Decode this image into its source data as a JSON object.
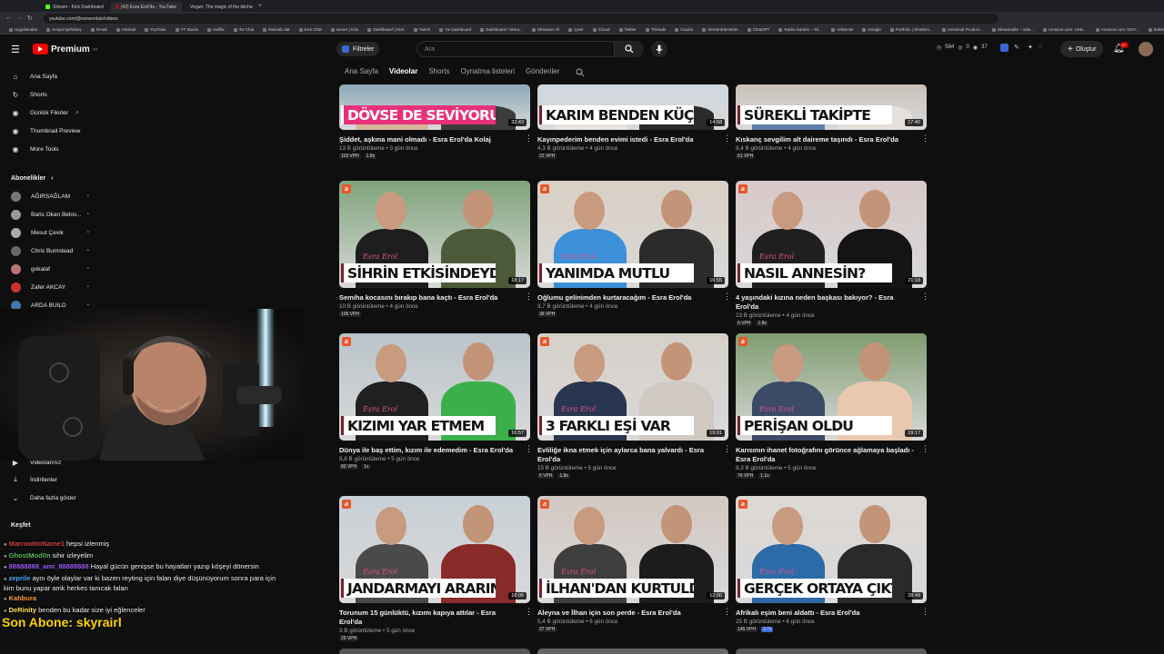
{
  "browser": {
    "tabs": [
      {
        "label": "Stream - Kick Dashboard",
        "color": "#53fc18"
      },
      {
        "label": "(42) Esra Erol'da - YouTube",
        "color": "#ff0000"
      },
      {
        "label": "Vegun: The magic of the kitchen",
        "color": "#4aa8ff"
      }
    ],
    "url": "youtube.com/@esraerolatv/videos",
    "bookmarks": [
      "Uygulamalar",
      "Sosyal Şehirbey",
      "Gmail",
      "Hotmail",
      "YouTube",
      "YT Studio",
      "Netflix",
      "Tw Chat",
      "festivali.clat",
      "Kick Chat",
      "server | Kick",
      "Dashboard | Kick",
      "Twitch",
      "Tw Dashboard",
      "Dashboard / Strea...",
      "Streamer Ali",
      "Çevir",
      "iCloud",
      "Twitter",
      "Threads",
      "Oculus",
      "StreamElements",
      "ChatGPT",
      "Radio Garden – Kil...",
      "AdSense",
      "Google",
      "Portfolio | Shutters...",
      "Universal Product...",
      "Streamable – vide...",
      "Amazon.com: USB...",
      "Amazon.com: NOV...",
      "Subreit a request...",
      "Drive & Listen",
      "Tüm Yer İşaretleri"
    ]
  },
  "header": {
    "logo": "Premium",
    "logo_sup": "TR",
    "filter_label": "Filtreler",
    "search_placeholder": "Ara",
    "stats": {
      "views": "584",
      "likes": "0",
      "watch": "37"
    },
    "create_label": "Oluştur",
    "notif_count": "9+"
  },
  "channel_tabs": [
    "Ana Sayfa",
    "Videolar",
    "Shorts",
    "Oynatma listeleri",
    "Gönderiler"
  ],
  "sidebar": {
    "items": [
      {
        "label": "Ana Sayfa",
        "icon": "home-icon",
        "glyph": "⌂"
      },
      {
        "label": "Shorts",
        "icon": "shorts-icon",
        "glyph": "↻"
      },
      {
        "label": "Günlük Fikirler",
        "icon": "ideas-icon",
        "glyph": "◉"
      },
      {
        "label": "Thumbnail Preview",
        "icon": "thumbnail-icon",
        "glyph": "◉"
      },
      {
        "label": "More Tools",
        "icon": "tools-icon",
        "glyph": "◉"
      }
    ],
    "subs_heading": "Abonelikler",
    "subs": [
      {
        "name": "AĞIRSAĞLAM",
        "color": "#777"
      },
      {
        "name": "Baris Okan Belov...",
        "color": "#999"
      },
      {
        "name": "Mesut Çevik",
        "color": "#aaa"
      },
      {
        "name": "Chris Bumstead",
        "color": "#666"
      },
      {
        "name": "gokalaf",
        "color": "#b77"
      },
      {
        "name": "Zafer AKCAY",
        "color": "#c33"
      },
      {
        "name": "ARDA BUILD",
        "color": "#47a"
      }
    ],
    "lower": [
      {
        "label": "Videolarınız",
        "icon": "play-icon",
        "glyph": "▶"
      },
      {
        "label": "İndirilenler",
        "icon": "download-icon",
        "glyph": "⤓"
      },
      {
        "label": "Daha fazla göster",
        "icon": "chevron-down-icon",
        "glyph": "⌄"
      }
    ],
    "explore_heading": "Keşfet"
  },
  "chat": [
    {
      "user": "MarrowNoName1",
      "text": "hepsi izlenmiş",
      "cls": "u1"
    },
    {
      "user": "GhostMod0n",
      "text": "sihir izleyelim",
      "cls": "u2"
    },
    {
      "user": "88888888_ami_88888888",
      "text": "Hayal gücün genişse bu hayatları yazıp köşeyi dönersin",
      "cls": "u3"
    },
    {
      "user": "zeprile",
      "text": "aynı öyle olaylar var ki bazen reyting için falan diye düşünüyorum sonra para için kim bunu yapar amk herkes tanıcak falan",
      "cls": "u4"
    },
    {
      "user": "Kahbura",
      "text": "",
      "cls": "u5"
    },
    {
      "user": "DeRinity",
      "text": "benden bu kadar size iyi eğlenceler",
      "cls": "u6"
    }
  ],
  "sub_alert": "Son Abone: skyrairl",
  "videos": [
    {
      "banner": "DÖVSE DE SEVİYORUM",
      "pink": true,
      "dur": "32:43",
      "title": "Şiddet, aşkına mani olmadı - Esra Erol'da Kolaj",
      "views": "13 B görüntüleme",
      "age": "3 gün önce",
      "vph": "118 VPH",
      "mult": "1.8x",
      "c1": "#d7b79a",
      "c2": "#3c3c3c",
      "bgc": "#8ea9b8"
    },
    {
      "banner": "KARIM BENDEN KÜÇÜK",
      "pink": false,
      "dur": "14:58",
      "title": "Kayınpederim benden evimi istedi - Esra Erol'da",
      "views": "4,3 B görüntüleme",
      "age": "4 gün önce",
      "vph": "22 VPH",
      "mult": "",
      "c1": "#e8e3df",
      "c2": "#2a2a2a",
      "bgc": "#cfd8df"
    },
    {
      "banner": "SÜREKLİ TAKİPTE",
      "pink": false,
      "dur": "17:40",
      "title": "Kıskanç sevgilim alt daireme taşındı - Esra Erol'da",
      "views": "9,4 B görüntüleme",
      "age": "4 gün önce",
      "vph": "61 VPH",
      "mult": "",
      "c1": "#5b7fa8",
      "c2": "#e6e0da",
      "bgc": "#c9c2bb"
    },
    {
      "banner": "SİHRİN ETKİSİNDEYDİM",
      "pink": false,
      "dur": "18:17",
      "title": "Semiha kocasını bırakıp bana kaçtı - Esra Erol'da",
      "views": "10 B görüntüleme",
      "age": "4 gün önce",
      "vph": "105 VPH",
      "mult": "",
      "c1": "#1e1e1e",
      "c2": "#4c5a3a",
      "bgc": "#7fa37a"
    },
    {
      "banner": "YANIMDA MUTLU",
      "pink": false,
      "dur": "16:55",
      "title": "Oğlumu gelinimden kurtaracağım - Esra Erol'da",
      "views": "3,7 B görüntüleme",
      "age": "4 gün önce",
      "vph": "38 VPH",
      "mult": "",
      "c1": "#3d8fd8",
      "c2": "#2b2b2b",
      "bgc": "#d9cfc4"
    },
    {
      "banner": "NASIL ANNESİN?",
      "pink": false,
      "dur": "21:18",
      "title": "4 yaşındaki kızına neden başkası bakıyor? - Esra Erol'da",
      "views": "23 B görüntüleme",
      "age": "4 gün önce",
      "vph": "6 VPH",
      "mult": "1.8x",
      "c1": "#1f1f1f",
      "c2": "#141414",
      "bgc": "#d8c8c8"
    },
    {
      "banner": "KIZIMI YAR ETMEM",
      "pink": false,
      "dur": "16:57",
      "title": "Dünya ile baş ettim, kızım ile edemedim - Esra Erol'da",
      "views": "9,8 B görüntüleme",
      "age": "5 gün önce",
      "vph": "80 VPH",
      "mult": "1x",
      "c1": "#202020",
      "c2": "#3bb04a",
      "bgc": "#b9c4c9"
    },
    {
      "banner": "3 FARKLI EŞİ VAR",
      "pink": false,
      "dur": "19:01",
      "title": "Evliliğe ikna etmek için aylarca bana yalvardı - Esra Erol'da",
      "views": "15 B görüntüleme",
      "age": "5 gün önce",
      "vph": "5 VPH",
      "mult": "1.8x",
      "c1": "#2a3550",
      "c2": "#cfc9c2",
      "bgc": "#d6d0c9"
    },
    {
      "banner": "PERİŞAN OLDU",
      "pink": false,
      "dur": "19:17",
      "title": "Karısının ihanet fotoğrafını görünce ağlamaya başladı - Esra Erol'da",
      "views": "9,3 B görüntüleme",
      "age": "5 gün önce",
      "vph": "76 VPH",
      "mult": "1.1x",
      "c1": "#3b4a66",
      "c2": "#e8c9b0",
      "bgc": "#7f9c70"
    },
    {
      "banner": "JANDARMAYI ARARIM",
      "pink": false,
      "dur": "18:06",
      "title": "Torunum 15 günlüktü, kızımı kapıya attılar - Esra Erol'da",
      "views": "3 B görüntüleme",
      "age": "5 gün önce",
      "vph": "25 VPH",
      "mult": "",
      "c1": "#4a4a4a",
      "c2": "#8b2a2a",
      "bgc": "#c8d0d6"
    },
    {
      "banner": "İLHAN'DAN KURTULDUM",
      "pink": false,
      "dur": "12:00",
      "title": "Aleyna ve İlhan için son perde - Esra Erol'da",
      "views": "5,4 B görüntüleme",
      "age": "6 gün önce",
      "vph": "37 VPH",
      "mult": "",
      "c1": "#3e3e3e",
      "c2": "#1c1c1c",
      "bgc": "#d3c8c2"
    },
    {
      "banner": "GERÇEK ORTAYA ÇIKTI",
      "pink": false,
      "dur": "28:49",
      "title": "Afrikalı eşim beni aldattı - Esra Erol'da",
      "views": "25 B görüntüleme",
      "age": "6 gün önce",
      "vph": "145 VPH",
      "mult": "3.7x",
      "c1": "#2c6aa8",
      "c2": "#2a2a2a",
      "bgc": "#dcd8d3"
    }
  ]
}
